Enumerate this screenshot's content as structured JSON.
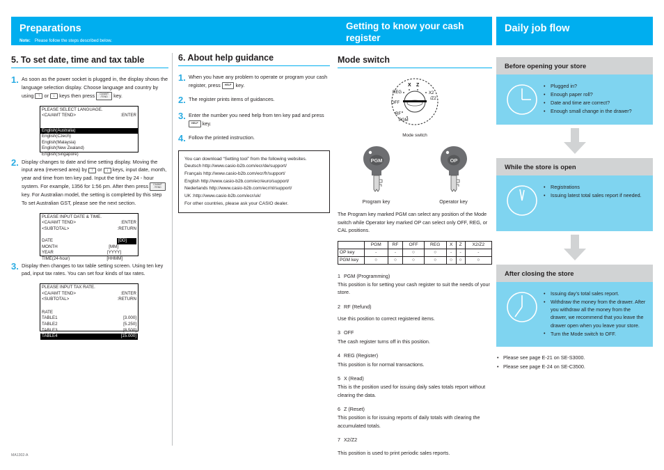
{
  "footer_code": "MA1302-A",
  "colors": {
    "accent": "#00aeef",
    "panel_light": "#7fd4f0",
    "panel_head": "#d1d3d4",
    "arrow": "#d1d3d4"
  },
  "col1": {
    "banner": {
      "title": "Preparations",
      "note_label": "Note:",
      "note_text": "Please follow the steps described below."
    },
    "heading": "5. To set date, time and tax table",
    "step1": {
      "num": "1.",
      "t1": "As soon as the power socket is plugged in, the display shows the language selection display. Choose language and country by using",
      "key_up": "↑",
      "t2": "or",
      "key_down": "↓",
      "t3": "keys then press",
      "key_ca_top": "CA/AMT",
      "key_ca_bot": "/TEND",
      "t4": "key."
    },
    "lcd1": {
      "line1": "PLEASE SELECT LANGUAGE.",
      "line2_left": "<CA/AMT TEND>",
      "line2_right": ":ENTER",
      "options": [
        {
          "label": "English(Australia)",
          "selected": true
        },
        {
          "label": "English(Czech)",
          "selected": false
        },
        {
          "label": "English(Malaysia)",
          "selected": false
        },
        {
          "label": "English(New Zealand)",
          "selected": false
        },
        {
          "label": "English(Singapore)",
          "selected": false
        }
      ]
    },
    "step2": {
      "num": "2.",
      "t1": "Display changes to date and time setting display. Moving the input area (reversed area) by",
      "key_up": "↑",
      "t2": "or",
      "key_down": "↓",
      "t3": "keys, input date, month, year and time from ten key pad. Input the time by 24 - hour system. For example, 1356 for 1:56 pm. After then press",
      "key_ca_top": "CA/AMT",
      "key_ca_bot": "/TEND",
      "t4": "key. For Australian model, the setting is completed by this step To set Australian GST, please see the next section."
    },
    "lcd2": {
      "line1": "PLEASE INPUT DATE & TIME.",
      "line2_left": "<CA/AMT TEND>",
      "line2_right": ":ENTER",
      "line3_left": "<SUBTOTAL>",
      "line3_right": ":RETURN",
      "fields": [
        {
          "label": "DATE",
          "value": "[DD]",
          "selected": true
        },
        {
          "label": "MONTH",
          "value": "[MM]",
          "selected": false
        },
        {
          "label": "YEAR",
          "value": "[YYYY]",
          "selected": false
        },
        {
          "label": "TIME(24-hour)",
          "value": "[HHMM]",
          "selected": false
        }
      ]
    },
    "step3": {
      "num": "3.",
      "text": "Display then changes to tax table setting screen. Using ten key pad, input tax rates. You can set four kinds of tax rates."
    },
    "lcd3": {
      "line1": "PLEASE INPUT TAX RATE.",
      "line2_left": "<CA/AMT TEND>",
      "line2_right": ":ENTER",
      "line3_left": "<SUBTOTAL>",
      "line3_right": ":RETURN",
      "rate_header": "RATE",
      "rows": [
        {
          "label": "TABLE1",
          "value": "[3.000]",
          "selected": false
        },
        {
          "label": "TABLE2",
          "value": "[5.250]",
          "selected": false
        },
        {
          "label": "TABLE3",
          "value": "[8.500]",
          "selected": false
        },
        {
          "label": "TABLE4",
          "value": "[15.000]",
          "selected": true
        }
      ]
    }
  },
  "col2": {
    "heading": "6. About help guidance",
    "steps": [
      {
        "num": "1.",
        "t1": "When you have any problem to operate or program your cash register, press",
        "key": "HELP",
        "t2": "key."
      },
      {
        "num": "2.",
        "t1": "The register prints items of guidances.",
        "key": "",
        "t2": ""
      },
      {
        "num": "3.",
        "t1": "Enter the number you need help from ten key pad and press",
        "key": "HELP",
        "t2": "key."
      },
      {
        "num": "4.",
        "t1": "Follow the printed instruction.",
        "key": "",
        "t2": ""
      }
    ],
    "download_box": {
      "intro": "You can download “Setting tool” from the following websites.",
      "lines": [
        "Deutsch http://www.casio-b2b.com/ecr/de/support/",
        "Français http://www.casio-b2b.com/ecr/fr/support/",
        "English http://www.casio-b2b.com/ecr/euro/support/",
        "Nederlands http://www.casio-b2b.com/ecr/nl/support/",
        "UK :http://www.casio-b2b.com/ecr/uk/"
      ],
      "outro": "For other countries, please ask your CASIO dealer."
    }
  },
  "col3": {
    "banner_title": "Getting to know your cash register",
    "heading": "Mode switch",
    "dial": {
      "labels": [
        "X",
        "Z",
        "REG",
        "X2",
        "/Z2",
        "OFF",
        "RF",
        "PGM"
      ],
      "caption": "Mode switch"
    },
    "keys": [
      {
        "cap": "PGM",
        "label": "Program key"
      },
      {
        "cap": "OP",
        "label": "Operator key"
      }
    ],
    "keys_note": "The Program key marked PGM can select any position of the Mode switch while Operator key marked OP can select only OFF, REG, or CAL positions.",
    "table": {
      "columns": [
        "",
        "PGM",
        "RF",
        "OFF",
        "REG",
        "X",
        "Z",
        "X2/Z2"
      ],
      "rows": [
        {
          "head": "OP key",
          "cells": [
            "-",
            "-",
            "○",
            "○",
            "-",
            "-",
            "-"
          ]
        },
        {
          "head": "PGM key",
          "cells": [
            "○",
            "○",
            "○",
            "○",
            "○",
            "○",
            "○"
          ]
        }
      ]
    },
    "positions": [
      {
        "n": "1",
        "title": "PGM (Programming)",
        "desc": "This position is for setting your cash register to suit the needs of your store."
      },
      {
        "n": "2",
        "title": "RF (Refund)",
        "desc": "Use this position to correct registered items."
      },
      {
        "n": "3",
        "title": "OFF",
        "desc": "The cash register turns off in this position."
      },
      {
        "n": "4",
        "title": "REG (Register)",
        "desc": "This position is for normal transactions."
      },
      {
        "n": "5",
        "title": "X (Read)",
        "desc": "This is the position used for issuing daily sales totals report without clearing the data."
      },
      {
        "n": "6",
        "title": "Z (Reset)",
        "desc": "This position is for issuing reports of daily totals with clearing the accumulated totals."
      },
      {
        "n": "7",
        "title": "X2/Z2",
        "desc": "This position is used to print periodic sales reports."
      }
    ]
  },
  "col4": {
    "banner_title": "Daily job flow",
    "sections": [
      {
        "head": "Before opening your store",
        "items": [
          "Plugged in?",
          "Enough paper roll?",
          "Date and time are correct?",
          "Enough small change in the drawer?"
        ]
      },
      {
        "head": "While the store is open",
        "items": [
          "Registrations",
          "Issuing latest total sales report if needed."
        ]
      },
      {
        "head": "After closing the store",
        "items": [
          "Issuing day’s total sales report.",
          "Withdraw the money from the drawer. After you withdraw all the money from the drawer, we recommend that you leave the drawer open when you leave your store.",
          "Turn the Mode switch to OFF."
        ]
      }
    ],
    "see_also": [
      "Please see page E-21 on SE-S3000.",
      "Please see page E-24 on SE-C3500."
    ]
  }
}
